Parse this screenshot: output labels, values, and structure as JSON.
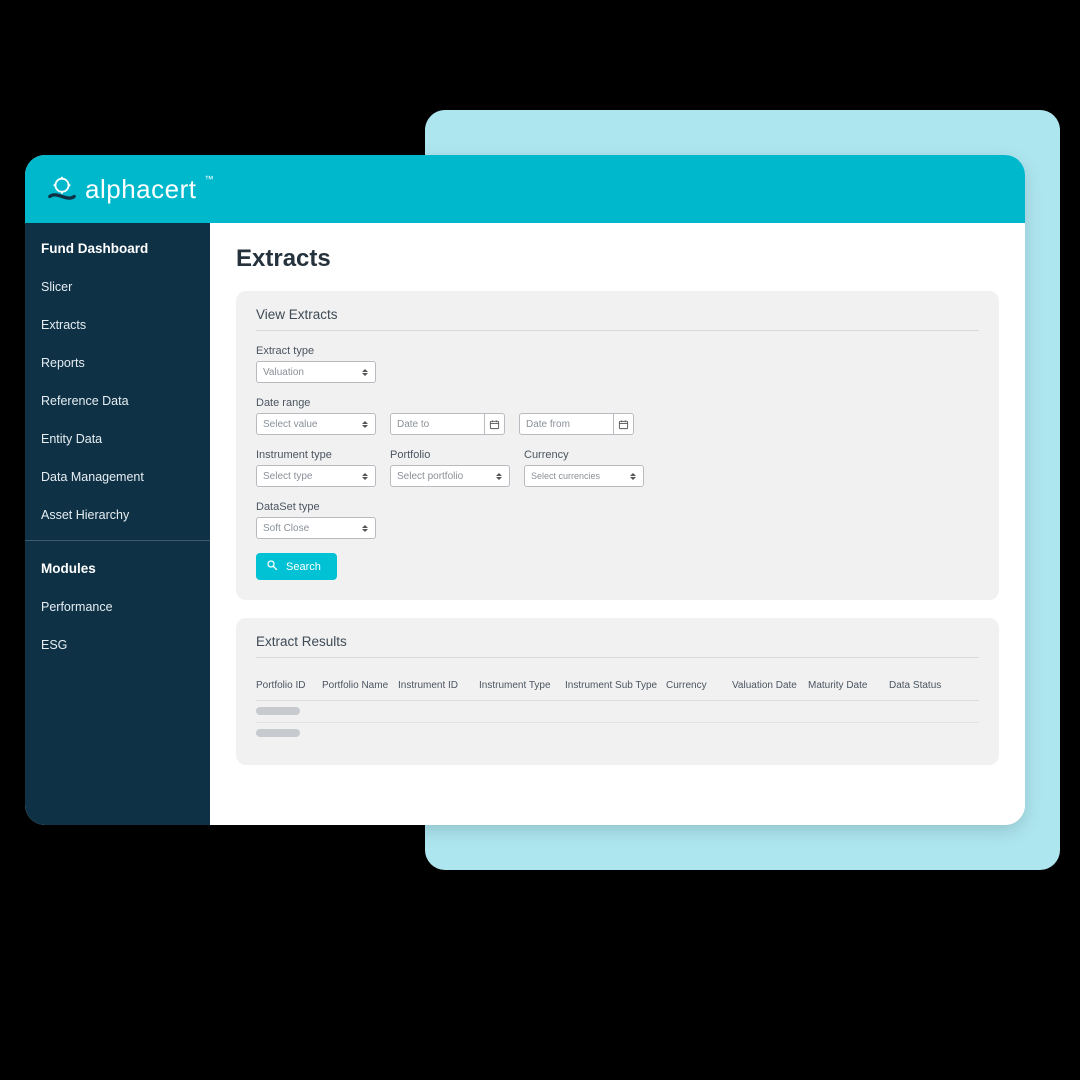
{
  "brand": {
    "name": "alphacert",
    "tm": "™"
  },
  "sidebar": {
    "section1_title": "Fund  Dashboard",
    "items1": [
      "Slicer",
      "Extracts",
      "Reports",
      "Reference Data",
      "Entity Data",
      "Data Management",
      "Asset Hierarchy"
    ],
    "section2_title": "Modules",
    "items2": [
      "Performance",
      "ESG"
    ]
  },
  "page": {
    "title": "Extracts"
  },
  "view": {
    "card_title": "View Extracts",
    "extract_type": {
      "label": "Extract type",
      "value": "Valuation"
    },
    "date_range": {
      "label": "Date range",
      "select_value": "Select value",
      "to_placeholder": "Date to",
      "from_placeholder": "Date from"
    },
    "instrument_type": {
      "label": "Instrument type",
      "value": "Select type"
    },
    "portfolio": {
      "label": "Portfolio",
      "value": "Select portfolio"
    },
    "currency": {
      "label": "Currency",
      "value": "Select currencies"
    },
    "dataset_type": {
      "label": "DataSet type",
      "value": "Soft Close"
    },
    "search_label": "Search"
  },
  "results": {
    "card_title": "Extract Results",
    "columns": [
      "Portfolio ID",
      "Portfolio Name",
      "Instrument ID",
      "Instrument Type",
      "Instrument Sub Type",
      "Currency",
      "Valuation Date",
      "Maturity Date",
      "Data Status"
    ]
  }
}
